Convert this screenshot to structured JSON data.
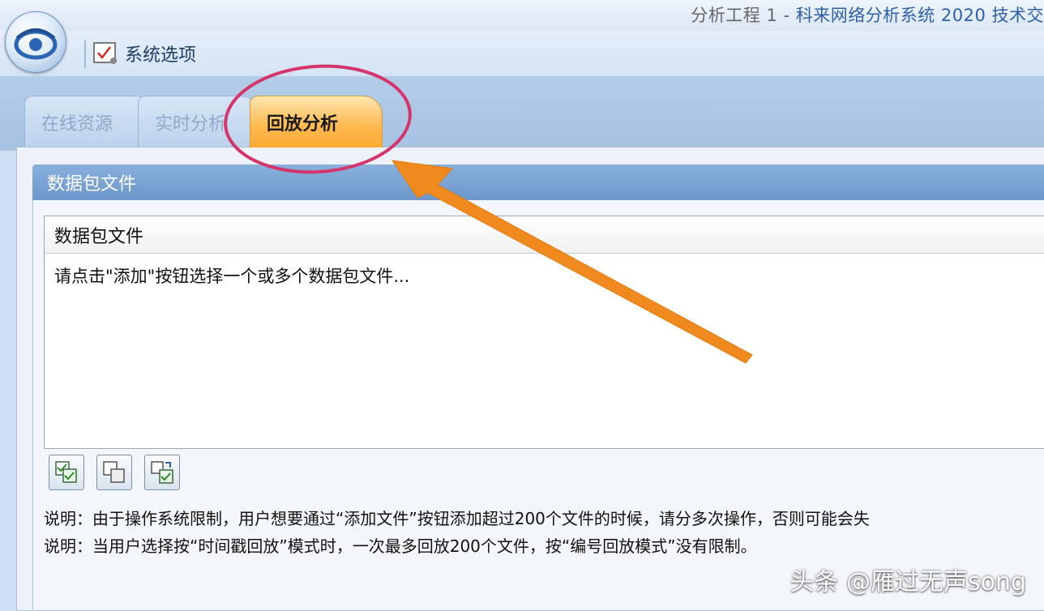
{
  "window": {
    "title_project": "分析工程 1 - ",
    "title_app": "科来网络分析系统 2020 技术交"
  },
  "ribbon": {
    "system_options_label": "系统选项"
  },
  "tabs": [
    {
      "label": "在线资源",
      "active": false
    },
    {
      "label": "实时分析",
      "active": false
    },
    {
      "label": "回放分析",
      "active": true
    }
  ],
  "packet_group": {
    "title": "数据包文件",
    "list_header": "数据包文件",
    "placeholder": "请点击\"添加\"按钮选择一个或多个数据包文件..."
  },
  "toolbar": [
    {
      "icon": "add-file-icon"
    },
    {
      "icon": "remove-file-icon"
    },
    {
      "icon": "replace-file-icon"
    }
  ],
  "notes": [
    "说明：由于操作系统限制，用户想要通过“添加文件”按钮添加超过200个文件的时候，请分多次操作，否则可能会失",
    "说明：当用户选择按“时间戳回放”模式时，一次最多回放200个文件，按“编号回放模式”没有限制。"
  ],
  "watermark": "头条 @雁过无声song",
  "colors": {
    "accent_tab": "#ffb84d",
    "annotation_circle": "#d6356b",
    "annotation_arrow": "#f08a1e"
  }
}
